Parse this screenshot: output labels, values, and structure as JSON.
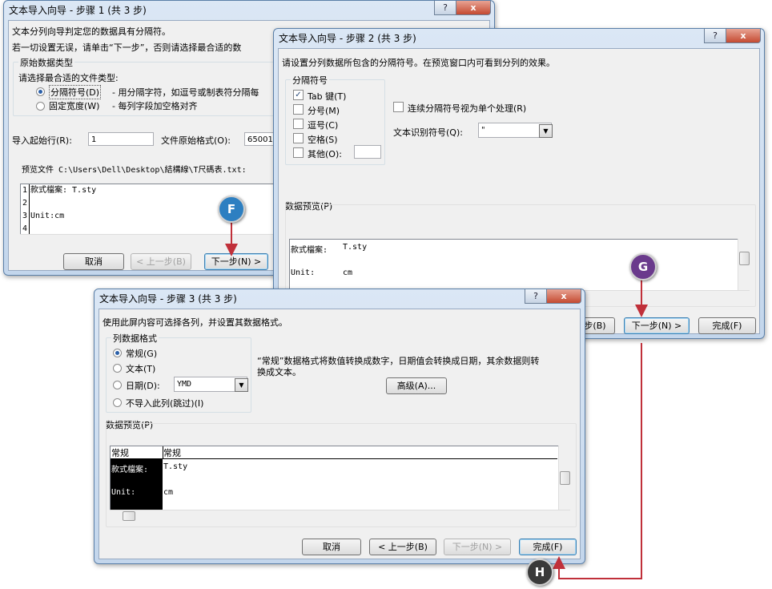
{
  "step1": {
    "title": "文本导入向导 - 步骤 1 (共 3 步)",
    "help": "?",
    "close": "x",
    "line1": "文本分列向导判定您的数据具有分隔符。",
    "line2": "若一切设置无误，请单击“下一步”，否则请选择最合适的数",
    "group_title": "原始数据类型",
    "choose_label": "请选择最合适的文件类型:",
    "opt_delimited": "分隔符号(D)",
    "opt_delimited_desc": "- 用分隔字符，如逗号或制表符分隔每",
    "opt_fixed": "固定宽度(W)",
    "opt_fixed_desc": "- 每列字段加空格对齐",
    "start_row_label": "导入起始行(R):",
    "start_row_value": "1",
    "origin_label": "文件原始格式(O):",
    "origin_value": "65001",
    "preview_file": "预览文件 C:\\Users\\Dell\\Desktop\\結構線\\T尺碼表.txt:",
    "preview_lines": [
      {
        "num": "1",
        "text": "款式檔案: T.sty"
      },
      {
        "num": "2",
        "text": ""
      },
      {
        "num": "3",
        "text": "Unit:cm"
      },
      {
        "num": "4",
        "text": ""
      }
    ],
    "cancel": "取消",
    "back": "< 上一步(B)",
    "next": "下一步(N) >"
  },
  "step2": {
    "title": "文本导入向导 - 步骤 2 (共 3 步)",
    "help": "?",
    "close": "x",
    "instruction": "请设置分列数据所包含的分隔符号。在预览窗口内可看到分列的效果。",
    "group_title": "分隔符号",
    "tab": "Tab 键(T)",
    "semicolon": "分号(M)",
    "comma": "逗号(C)",
    "space": "空格(S)",
    "other": "其他(O):",
    "consecutive": "连续分隔符号视为单个处理(R)",
    "qualifier_label": "文本识别符号(Q):",
    "qualifier_value": "\"",
    "preview_label": "数据预览(P)",
    "preview_rows": [
      [
        "款式檔案:",
        "T.sty"
      ],
      [
        "Unit:",
        "cm"
      ]
    ],
    "back": "步(B)",
    "next": "下一步(N) >",
    "finish": "完成(F)"
  },
  "step3": {
    "title": "文本导入向导 - 步骤 3 (共 3 步)",
    "help": "?",
    "close": "x",
    "instruction": "使用此屏内容可选择各列，并设置其数据格式。",
    "group_title": "列数据格式",
    "general": "常规(G)",
    "text": "文本(T)",
    "date": "日期(D):",
    "date_value": "YMD",
    "skip": "不导入此列(跳过)(I)",
    "desc1": "“常规”数据格式将数值转换成数字，日期值会转换成日期，其余数据则转",
    "desc2": "换成文本。",
    "advanced": "高级(A)...",
    "preview_label": "数据预览(P)",
    "headers": [
      "常规",
      "常规"
    ],
    "preview_rows": [
      [
        "款式檔案:",
        "T.sty"
      ],
      [
        "Unit:",
        "cm"
      ]
    ],
    "cancel": "取消",
    "back": "< 上一步(B)",
    "next": "下一步(N) >",
    "finish": "完成(F)"
  },
  "markers": {
    "f": "F",
    "g": "G",
    "h": "H"
  },
  "colors": {
    "marker_f": "#2d7fc1",
    "marker_g": "#6a3a8c",
    "marker_h": "#3a3a3a",
    "arrow": "#c0303a"
  }
}
